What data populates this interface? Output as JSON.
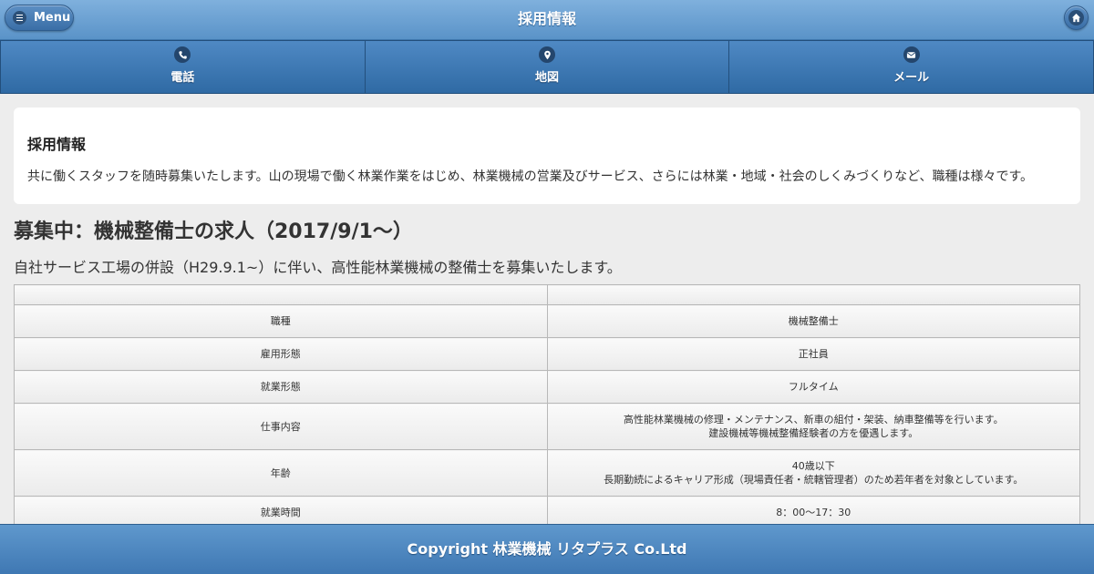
{
  "header": {
    "title": "採用情報",
    "menu_label": "Menu",
    "menu_icon": "bars-icon",
    "home_icon": "home-icon"
  },
  "navbar": {
    "items": [
      {
        "label": "電話",
        "icon": "phone-icon"
      },
      {
        "label": "地図",
        "icon": "map-pin-icon"
      },
      {
        "label": "メール",
        "icon": "mail-icon"
      }
    ]
  },
  "intro": {
    "heading": "採用情報",
    "text": "共に働くスタッフを随時募集いたします。山の現場で働く林業作業をはじめ、林業機械の営業及びサービス、さらには林業・地域・社会のしくみづくりなど、職種は様々です。"
  },
  "job": {
    "title": "募集中：機械整備士の求人（2017/9/1～）",
    "description": "自社サービス工場の併設（H29.9.1~）に伴い、高性能林業機械の整備士を募集いたします。",
    "table_header": [
      "",
      ""
    ],
    "rows": [
      {
        "label": "職種",
        "lines": [
          "機械整備士"
        ]
      },
      {
        "label": "雇用形態",
        "lines": [
          "正社員"
        ]
      },
      {
        "label": "就業形態",
        "lines": [
          "フルタイム"
        ]
      },
      {
        "label": "仕事内容",
        "lines": [
          "高性能林業機械の修理・メンテナンス、新車の組付・架装、納車整備等を行います。",
          "建設機械等機械整備経験者の方を優遇します。"
        ]
      },
      {
        "label": "年齢",
        "lines": [
          "40歳以下",
          "長期勤続によるキャリア形成（現場責任者・統轄管理者）のため若年者を対象としています。"
        ]
      },
      {
        "label": "就業時間",
        "lines": [
          "8：00～17：30"
        ]
      }
    ]
  },
  "footer": {
    "text": "Copyright 林業機械 リタプラス Co.Ltd"
  },
  "colors": {
    "header": "#6ea3d4",
    "navbar": "#3f79b4",
    "footer": "#4f88c0",
    "background": "#ededed"
  }
}
